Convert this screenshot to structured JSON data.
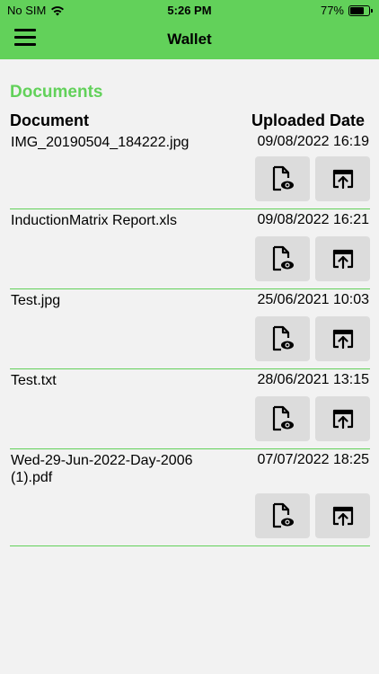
{
  "status_bar": {
    "carrier": "No SIM",
    "time": "5:26 PM",
    "battery_percent": "77%",
    "battery_level": 0.77
  },
  "header": {
    "title": "Wallet",
    "menu_icon": "hamburger-menu-icon"
  },
  "section": {
    "title": "Documents",
    "column_document": "Document",
    "column_date": "Uploaded Date"
  },
  "documents": [
    {
      "name": "IMG_20190504_184222.jpg",
      "uploaded": "09/08/2022 16:19"
    },
    {
      "name": "InductionMatrix Report.xls",
      "uploaded": "09/08/2022 16:21"
    },
    {
      "name": "Test.jpg",
      "uploaded": "25/06/2021 10:03"
    },
    {
      "name": "Test.txt",
      "uploaded": "28/06/2021 13:15"
    },
    {
      "name": "Wed-29-Jun-2022-Day-2006 (1).pdf",
      "uploaded": "07/07/2022 18:25"
    }
  ],
  "icons": {
    "view": "file-view-icon",
    "upload": "upload-icon"
  },
  "colors": {
    "accent": "#62d15a",
    "background": "#f2f2f2",
    "button": "#dcdcdc"
  }
}
